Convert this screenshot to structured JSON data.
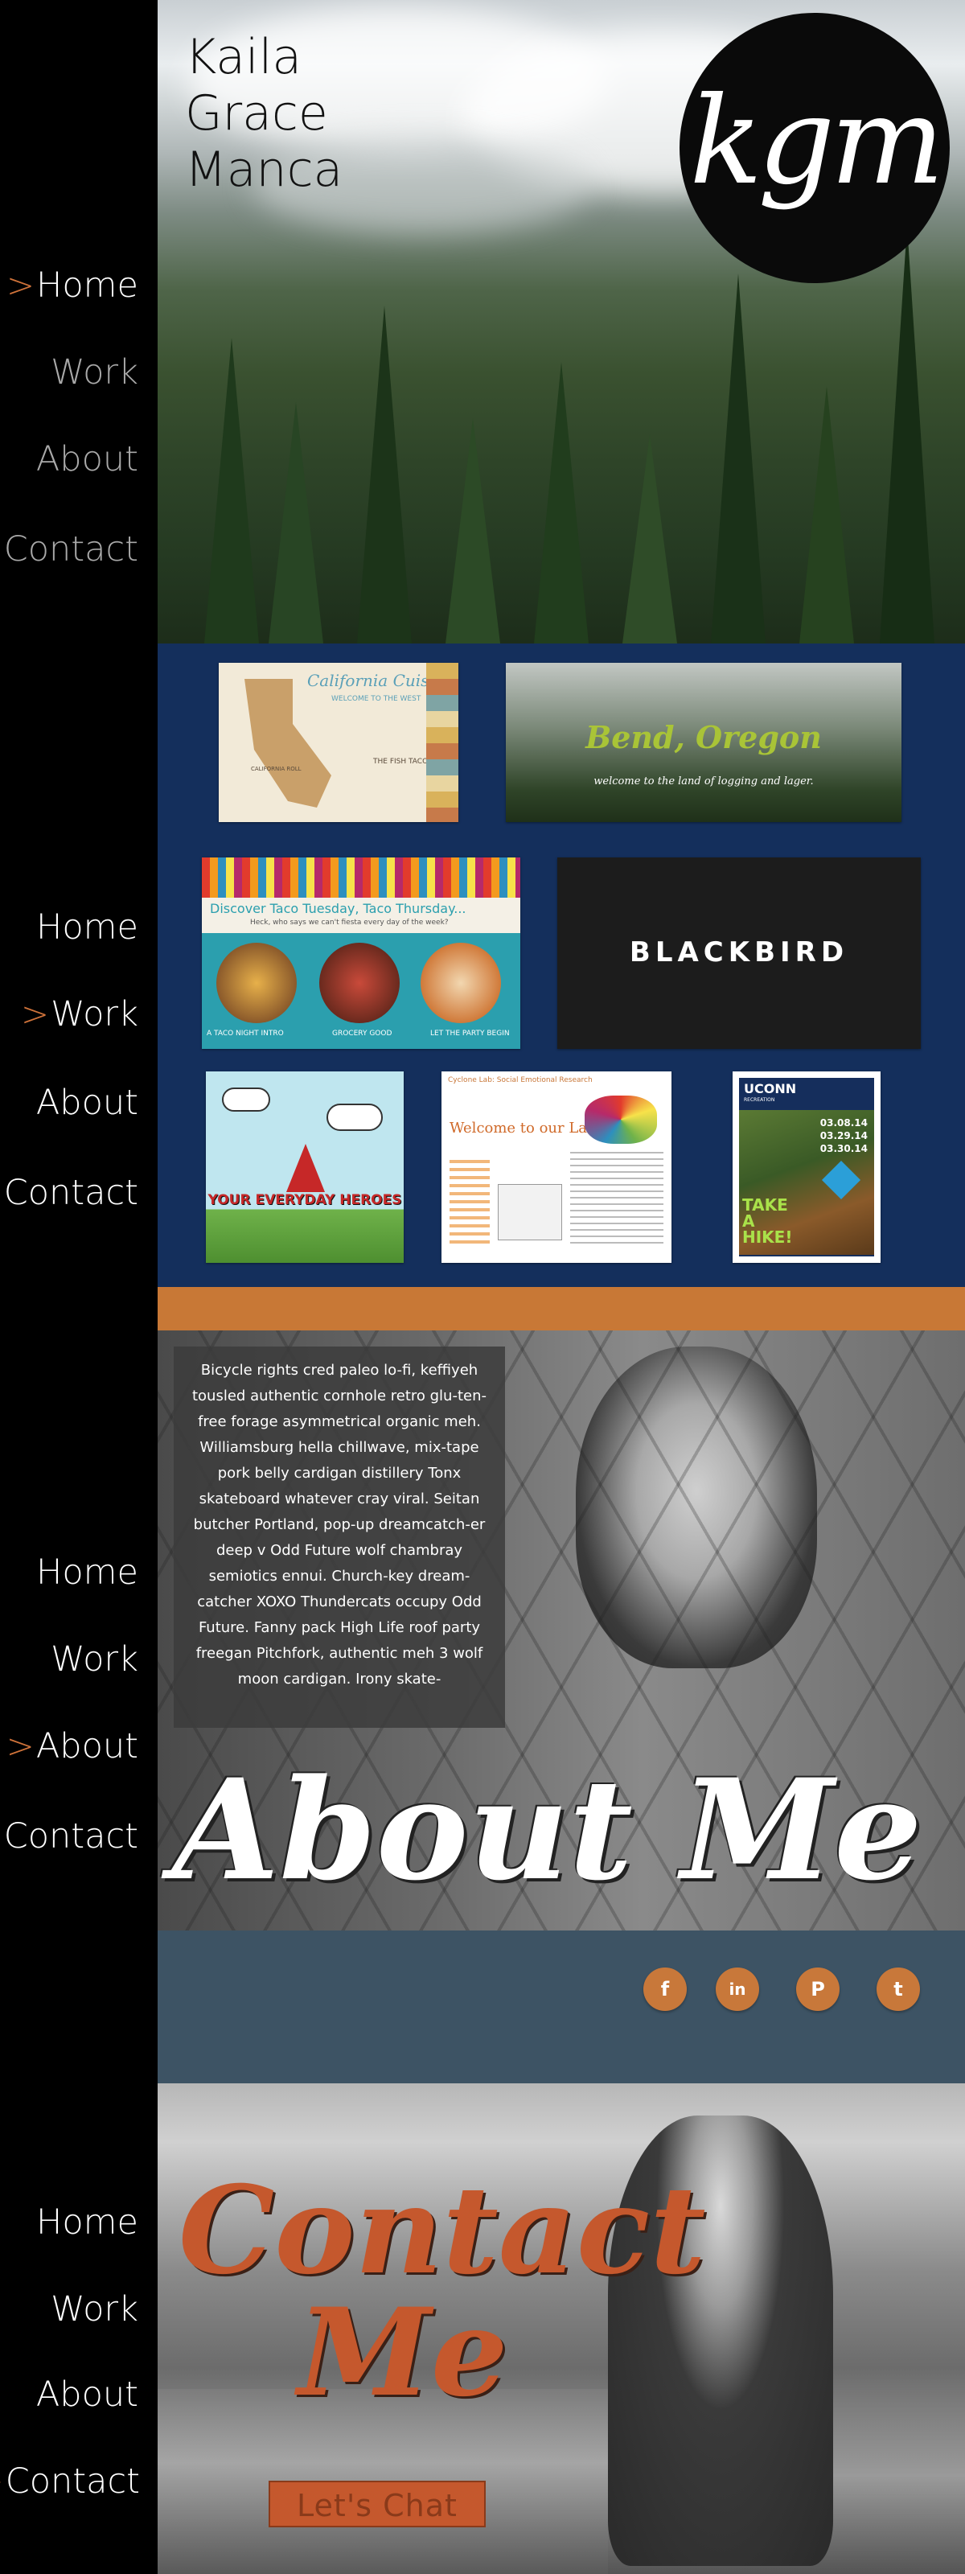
{
  "hero": {
    "name_line1": "Kaila",
    "name_line2": "Grace",
    "name_line3": "Manca",
    "logo_text": "kgm"
  },
  "nav_sections": [
    {
      "home": "Home",
      "work": "Work",
      "about": "About",
      "contact": "Contact",
      "active": "home"
    },
    {
      "home": "Home",
      "work": "Work",
      "about": "About",
      "contact": "Contact",
      "active": "work"
    },
    {
      "home": "Home",
      "work": "Work",
      "about": "About",
      "contact": "Contact",
      "active": "about"
    },
    {
      "home": "Home",
      "work": "Work",
      "about": "About",
      "contact": "Contact",
      "active": "contact"
    }
  ],
  "work": {
    "california": {
      "title": "California Cuisine",
      "subtitle": "WELCOME TO THE WEST",
      "caption": "THE FISH TACO",
      "caption2": "CALIFORNIA ROLL"
    },
    "bend": {
      "title": "Bend, Oregon",
      "subtitle": "welcome to the land of logging and lager."
    },
    "taco": {
      "title": "Discover Taco Tuesday, Taco Thursday...",
      "subtitle": "Heck, who says we can't fiesta every day of the week?",
      "caption1": "A TACO NIGHT INTRO",
      "caption2": "GROCERY GOOD",
      "caption3": "LET THE PARTY BEGIN"
    },
    "blackbird": {
      "title": "BLACKBIRD"
    },
    "heroes": {
      "title": "YOUR EVERYDAY HEROES"
    },
    "lab": {
      "header": "Cyclone Lab: Social Emotional Research",
      "title": "Welcome to our Lab!"
    },
    "uconn": {
      "title": "UCONN",
      "subtitle": "RECREATION",
      "dates": [
        "03.08.14",
        "03.29.14",
        "03.30.14"
      ],
      "cta": "TAKE A HIKE!"
    }
  },
  "about": {
    "bio": "Bicycle rights cred paleo lo-fi, keffiyeh tousled authentic cornhole retro glu-ten-free forage asymmetrical organic meh. Williamsburg hella chillwave, mix-tape pork belly cardigan distillery Tonx skateboard whatever cray viral. Seitan butcher Portland, pop-up dreamcatch-er deep v Odd Future wolf chambray semiotics ennui. Church-key dream-catcher XOXO Thundercats occupy Odd Future. Fanny pack High Life roof party freegan Pitchfork, authentic meh 3 wolf moon cardigan. Irony skate-",
    "title": "About Me"
  },
  "social": {
    "facebook": "f",
    "linkedin": "in",
    "pinterest": "P",
    "twitter": "t",
    "accent": "#c8783a"
  },
  "contact": {
    "title_line1": "Contact",
    "title_line2": "Me",
    "button": "Let's Chat"
  },
  "colors": {
    "accent": "#d0733a",
    "work_bg": "#142f5c",
    "social_bg": "#3d5364",
    "contact_orange": "#c5582d"
  }
}
